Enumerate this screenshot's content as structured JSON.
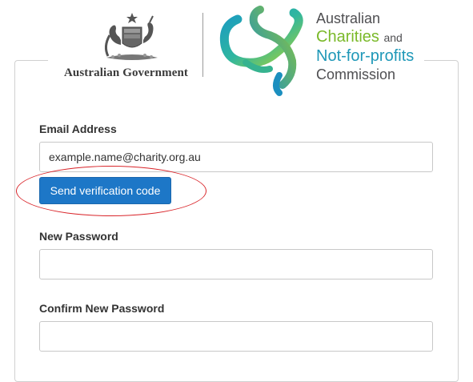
{
  "header": {
    "gov_text": "Australian Government",
    "acnc_line1": "Australian",
    "acnc_line2": "Charities",
    "acnc_line2_suffix": "and",
    "acnc_line3": "Not-for-profits",
    "acnc_line4": "Commission",
    "crest_icon": "coat-of-arms-icon",
    "acnc_icon": "acnc-map-ribbon-icon"
  },
  "form": {
    "email_label": "Email Address",
    "email_value": "example.name@charity.org.au",
    "send_code_label": "Send verification code",
    "new_password_label": "New Password",
    "new_password_value": "",
    "confirm_password_label": "Confirm New Password",
    "confirm_password_value": ""
  },
  "colors": {
    "button": "#1d77c7",
    "highlight": "#d9252a",
    "acnc_green": "#7ab929",
    "acnc_teal": "#1f98b8"
  }
}
